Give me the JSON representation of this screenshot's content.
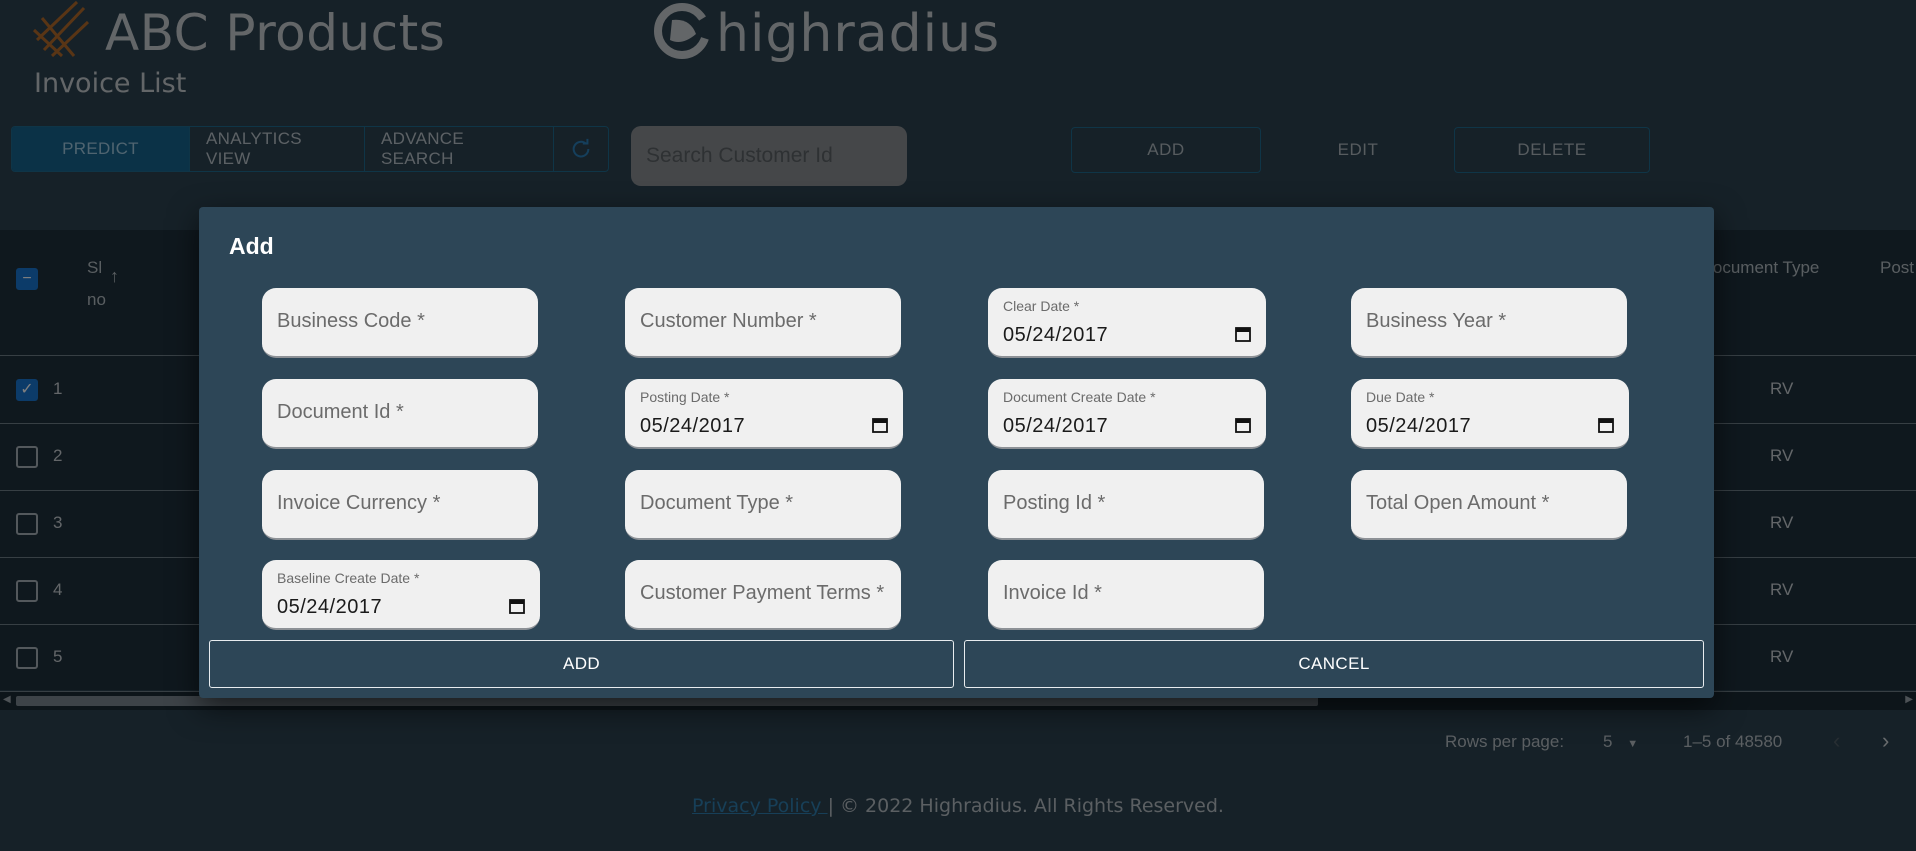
{
  "header": {
    "brand_title": "ABC Products",
    "partner_title": "highradius",
    "page_subtitle": "Invoice List"
  },
  "toolbar": {
    "predict_label": "PREDICT",
    "analytics_label": "ANALYTICS VIEW",
    "advance_search_label": "ADVANCE SEARCH",
    "refresh_icon": "refresh-icon",
    "search_placeholder": "Search Customer Id",
    "add_label": "ADD",
    "edit_label": "EDIT",
    "delete_label": "DELETE"
  },
  "table": {
    "col_slno": "Sl no",
    "col_doctype": "Document Type",
    "col_post": "Post",
    "rows": [
      {
        "num": "1",
        "doc_type": "RV",
        "checked": true
      },
      {
        "num": "2",
        "doc_type": "RV",
        "checked": false
      },
      {
        "num": "3",
        "doc_type": "RV",
        "checked": false
      },
      {
        "num": "4",
        "doc_type": "RV",
        "checked": false
      },
      {
        "num": "5",
        "doc_type": "RV",
        "checked": false
      }
    ]
  },
  "pagination": {
    "rows_per_page_label": "Rows per page:",
    "rows_per_page_value": "5",
    "range": "1–5 of 48580"
  },
  "footer": {
    "privacy_link": "Privacy Policy ",
    "copyright": "| © 2022 Highradius. All Rights Reserved."
  },
  "dialog": {
    "title": "Add",
    "fields": {
      "business_code": "Business Code *",
      "customer_number": "Customer Number *",
      "clear_date_label": "Clear Date *",
      "clear_date_value": "05/24/2017",
      "business_year": "Business Year *",
      "document_id": "Document Id *",
      "posting_date_label": "Posting Date *",
      "posting_date_value": "05/24/2017",
      "doc_create_date_label": "Document Create Date *",
      "doc_create_date_value": "05/24/2017",
      "due_date_label": "Due Date *",
      "due_date_value": "05/24/2017",
      "invoice_currency": "Invoice Currency *",
      "document_type": "Document Type *",
      "posting_id": "Posting Id *",
      "total_open_amount": "Total Open Amount *",
      "baseline_create_date_label": "Baseline Create Date *",
      "baseline_create_date_value": "05/24/2017",
      "customer_payment_terms": "Customer Payment Terms *",
      "invoice_id": "Invoice Id *"
    },
    "add_button": "ADD",
    "cancel_button": "CANCEL"
  }
}
